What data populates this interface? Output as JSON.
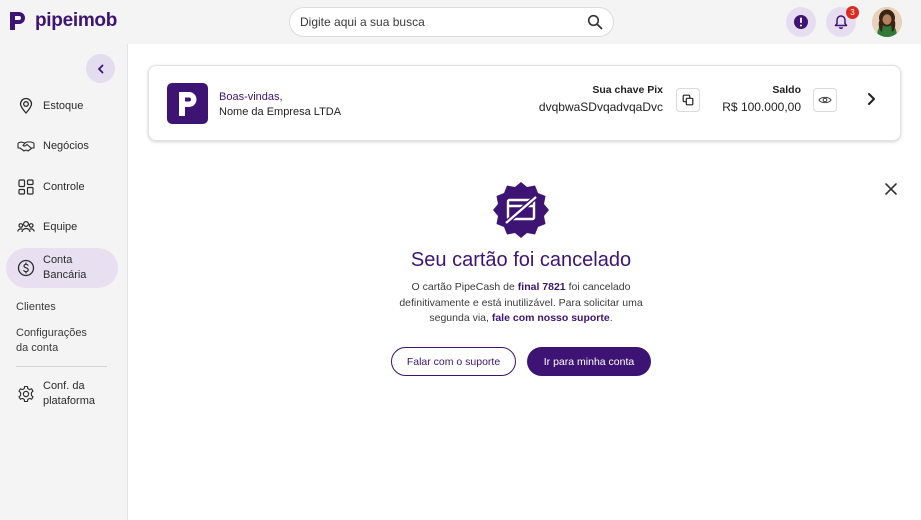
{
  "brand": {
    "name": "pipeimob",
    "color": "#3d1473"
  },
  "header": {
    "search": {
      "placeholder": "Digite aqui a sua busca",
      "icon": "search-icon"
    },
    "alert_icon": "exclamation-icon",
    "notifications": {
      "icon": "bell-icon",
      "count": "3"
    },
    "avatar": "user-avatar"
  },
  "sidebar": {
    "collapse_icon": "chevron-left-icon",
    "items": [
      {
        "label": "Estoque",
        "icon": "location-pin-icon"
      },
      {
        "label": "Negócios",
        "icon": "handshake-icon"
      },
      {
        "label": "Controle",
        "icon": "grid-icon"
      },
      {
        "label": "Equipe",
        "icon": "team-icon"
      },
      {
        "label": "Conta Bancária",
        "icon": "dollar-circle-icon",
        "active": true
      }
    ],
    "sub_items": [
      {
        "label": "Clientes"
      },
      {
        "label": "Configurações da conta"
      }
    ],
    "platform": {
      "label": "Conf. da plataforma",
      "icon": "gear-icon"
    }
  },
  "account_card": {
    "welcome": "Boas-vindas,",
    "company": "Nome da Empresa LTDA",
    "pix_label": "Sua chave Pix",
    "pix_key": "dvqbwaSDvqadvqaDvc",
    "copy_icon": "copy-icon",
    "balance_label": "Saldo",
    "balance_value": "R$ 100.000,00",
    "eye_icon": "eye-icon",
    "chevron_icon": "chevron-right-icon"
  },
  "notice": {
    "close_icon": "close-icon",
    "seal_icon": "card-cancelled-seal-icon",
    "title": "Seu cartão foi cancelado",
    "desc_1": "O cartão PipeCash de ",
    "desc_bold_1": "final 7821",
    "desc_2": " foi cancelado definitivamente e está inutilizável. Para solicitar uma segunda via, ",
    "desc_bold_2": "fale com nosso suporte",
    "desc_3": ".",
    "btn_support": "Falar com o suporte",
    "btn_account": "Ir para minha conta"
  }
}
